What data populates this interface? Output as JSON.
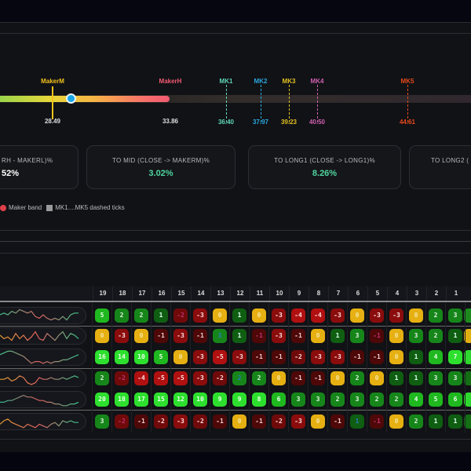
{
  "gauge": {
    "maker_m": {
      "label": "MakerM",
      "value": "28.49",
      "color": "#f2c21b"
    },
    "maker_h": {
      "label": "MakerH",
      "value": "33.86",
      "color": "#f25a72"
    },
    "ticks": [
      {
        "label": "MK1",
        "value": "36.40",
        "color": "#5fd6b8"
      },
      {
        "label": "MK2",
        "value": "37.97",
        "color": "#2ba8e0"
      },
      {
        "label": "MK3",
        "value": "39.23",
        "color": "#e0c020"
      },
      {
        "label": "MK4",
        "value": "40.50",
        "color": "#d060b0"
      },
      {
        "label": "MK5",
        "value": "44.61",
        "color": "#e84a1a"
      }
    ]
  },
  "cards": [
    {
      "label": "RH - MAKERL)%",
      "value": "52%",
      "color": "#ffffff"
    },
    {
      "label": "TO MID (CLOSE -> MAKERM)%",
      "value": "3.02%",
      "color": "#4fd6a0"
    },
    {
      "label": "TO LONG1 (CLOSE -> LONG1)%",
      "value": "8.26%",
      "color": "#4fd6a0"
    },
    {
      "label": "TO LONG2 (",
      "value": "",
      "color": "#4fd6a0"
    }
  ],
  "legend": [
    {
      "label": "Maker band",
      "color": "#e0404a"
    },
    {
      "label": "MK1....MK5 dashed ticks",
      "color": "#9a9a9a"
    }
  ],
  "table": {
    "columns": [
      "19",
      "18",
      "17",
      "16",
      "15",
      "14",
      "13",
      "12",
      "11",
      "10",
      "9",
      "8",
      "7",
      "6",
      "5",
      "4",
      "3",
      "2",
      "1"
    ],
    "rows": [
      {
        "values": [
          5,
          2,
          2,
          1,
          -2,
          -3,
          0,
          1,
          0,
          -3,
          -4,
          -4,
          -3,
          0,
          -3,
          -3,
          0,
          2,
          3
        ],
        "dim": [
          4
        ],
        "spark": [
          5,
          6,
          5,
          7,
          6,
          8,
          7,
          6,
          7,
          4,
          3,
          5,
          3,
          2,
          3,
          2,
          4,
          2,
          5,
          6,
          6
        ]
      },
      {
        "values": [
          0,
          -3,
          0,
          -1,
          -3,
          -1,
          3,
          1,
          -1,
          -3,
          -1,
          0,
          1,
          3,
          -1,
          0,
          3,
          2,
          1
        ],
        "dim": [
          6,
          8,
          14
        ],
        "spark": [
          5,
          3,
          4,
          2,
          6,
          3,
          5,
          2,
          4,
          7,
          3,
          2,
          6,
          4,
          2,
          5,
          7,
          3,
          6,
          5,
          3
        ]
      },
      {
        "values": [
          16,
          14,
          10,
          5,
          0,
          -3,
          -5,
          -3,
          -1,
          -1,
          -2,
          -3,
          -3,
          -1,
          -1,
          0,
          1,
          4,
          7
        ],
        "dim": [],
        "spark": [
          6,
          7,
          8,
          8,
          7,
          6,
          5,
          3,
          1,
          2,
          2,
          1,
          2,
          1,
          2,
          2,
          3,
          3,
          4,
          5,
          6
        ]
      },
      {
        "values": [
          2,
          -2,
          -4,
          -5,
          -5,
          -3,
          -2,
          2,
          2,
          0,
          -1,
          -1,
          0,
          2,
          0,
          1,
          1,
          3,
          3
        ],
        "dim": [
          1,
          7
        ],
        "spark": [
          4,
          4,
          5,
          3,
          4,
          6,
          5,
          2,
          1,
          2,
          5,
          4,
          4,
          5,
          4,
          4,
          5,
          4,
          5,
          6,
          5
        ]
      },
      {
        "values": [
          20,
          18,
          17,
          15,
          12,
          10,
          9,
          9,
          8,
          6,
          3,
          3,
          2,
          3,
          2,
          2,
          4,
          5,
          6
        ],
        "dim": [],
        "spark": [
          3,
          3,
          4,
          4,
          5,
          6,
          7,
          6,
          6,
          5,
          4,
          4,
          3,
          3,
          2,
          2,
          1,
          1,
          2,
          2,
          3
        ]
      },
      {
        "values": [
          3,
          -2,
          -1,
          -2,
          -3,
          -2,
          -1,
          0,
          -1,
          -2,
          -3,
          0,
          -1,
          1,
          -1,
          0,
          2,
          1,
          1
        ],
        "dim": [
          1,
          13,
          14
        ],
        "spark": [
          3,
          5,
          6,
          4,
          3,
          2,
          1,
          3,
          2,
          1,
          3,
          2,
          1,
          3,
          4,
          2,
          5,
          4,
          5,
          4,
          4
        ]
      }
    ],
    "partial_column_colors": [
      "#1e8a1e",
      "#e0b010",
      "#2ed82e",
      "#146e14",
      "#2ed82e",
      "#146e14"
    ]
  }
}
